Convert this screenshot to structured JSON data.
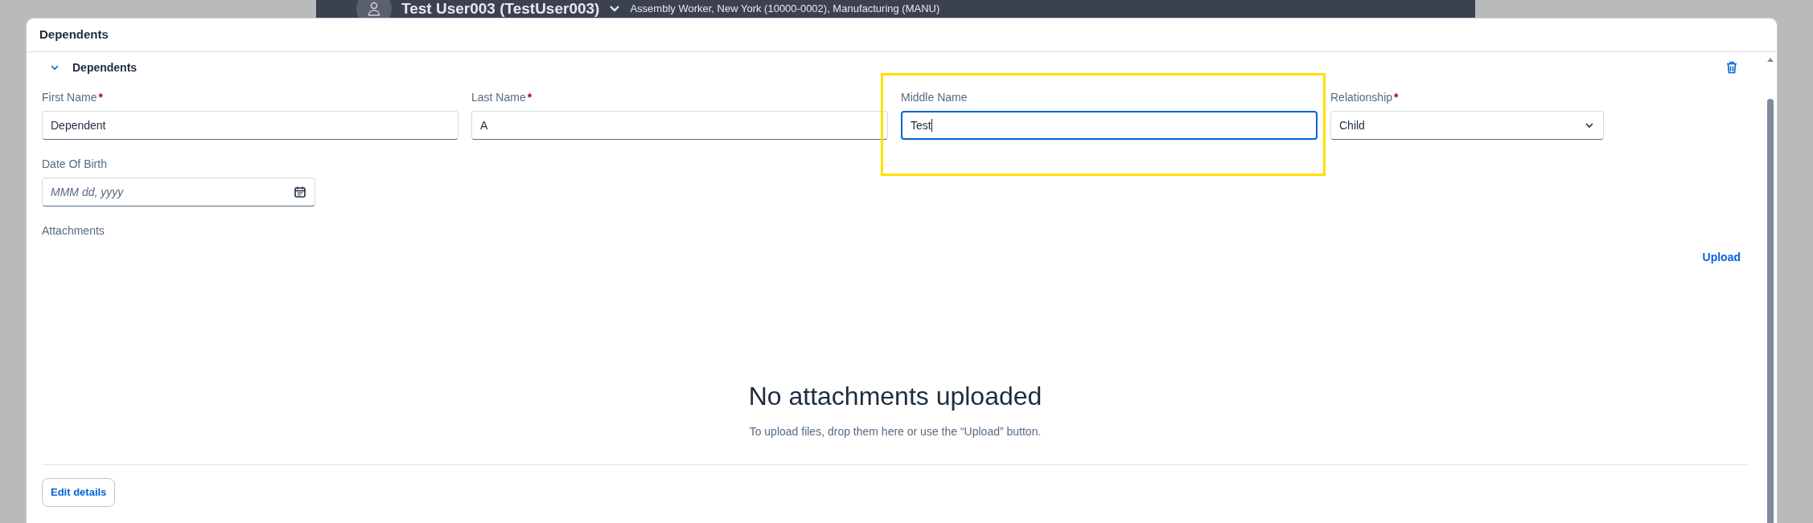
{
  "background_header": {
    "name": "Test User003 (TestUser003)",
    "details": "Assembly Worker, New York (10000-0002), Manufacturing (MANU)"
  },
  "dialog": {
    "title": "Dependents"
  },
  "section": {
    "title": "Dependents",
    "expanded": true
  },
  "fields": [
    {
      "kind": "text",
      "label": "First Name",
      "required_mark": "*",
      "value": "Dependent",
      "focused": false
    },
    {
      "kind": "text",
      "label": "Last Name",
      "required_mark": "*",
      "value": "A",
      "focused": false
    },
    {
      "kind": "text",
      "label": "Middle Name",
      "value": "Test",
      "focused": true
    },
    {
      "kind": "select",
      "label": "Relationship",
      "required_mark": "*",
      "value": "Child",
      "focused": false
    },
    {
      "kind": "date",
      "label": "Date Of Birth",
      "placeholder": "MMM dd, yyyy",
      "focused": false
    }
  ],
  "attachments": {
    "label": "Attachments",
    "upload_link": "Upload",
    "empty_title": "No attachments uploaded",
    "empty_text": "To upload files, drop them here or use the “Upload” button."
  },
  "edit_button": "Edit details"
}
